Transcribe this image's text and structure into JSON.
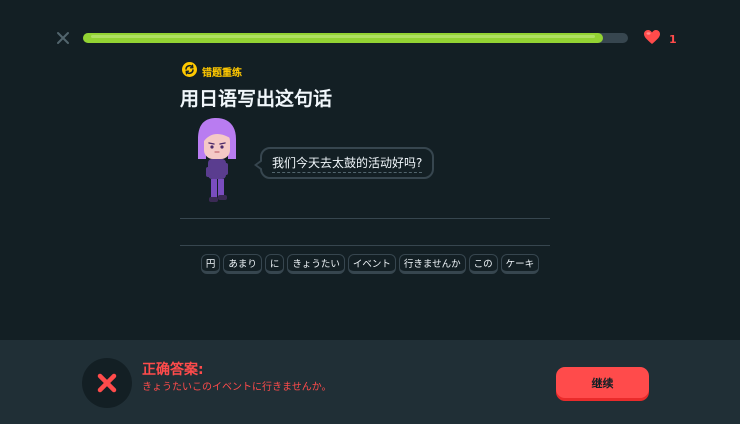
{
  "header": {
    "close_icon": "close-icon",
    "progress_fraction": 0.955,
    "hearts_count": "1",
    "heart_icon": "heart-icon"
  },
  "lesson": {
    "badge_icon": "refresh-icon",
    "badge_label": "错题重练",
    "title": "用日语写出这句话",
    "prompt": "我们今天去太鼓的活动好吗?"
  },
  "word_bank": [
    "円",
    "あまり",
    "に",
    "きょうたい",
    "イベント",
    "行きませんか",
    "この",
    "ケーキ"
  ],
  "footer": {
    "status_icon": "x-icon",
    "title": "正确答案:",
    "answer": "きょうたいこのイベントに行きませんか。",
    "continue_label": "继续"
  },
  "colors": {
    "background": "#131f24",
    "progress": "#93d333",
    "error": "#ff4b4b",
    "badge": "#ffc800",
    "footer": "#202f36"
  }
}
